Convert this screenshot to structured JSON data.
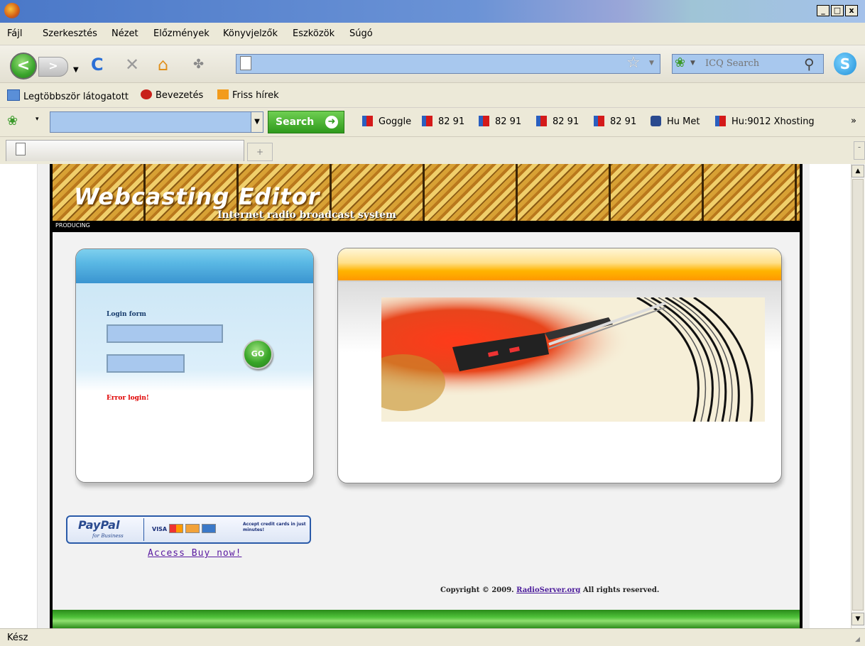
{
  "menu": [
    "Fájl",
    "Szerkesztés",
    "Nézet",
    "Előzmények",
    "Könyvjelzők",
    "Eszközök",
    "Súgó"
  ],
  "window_buttons": [
    "_",
    "□",
    "x"
  ],
  "nav": {
    "back_glyph": "<",
    "forward_glyph": ">",
    "reload_glyph": "C",
    "stop_glyph": "✕",
    "home_glyph": "⌂",
    "url_value": "",
    "bookmark_star": "☆",
    "icq_placeholder": "ICQ Search",
    "skype_glyph": "S"
  },
  "bookmarks": [
    "Legtöbbször látogatott",
    "Bevezetés",
    "Friss hírek"
  ],
  "toolbar": {
    "search_label": "Search",
    "search_value": "",
    "links": [
      "Goggle",
      "82 91",
      "82 91",
      "82 91",
      "82 91",
      "Hu Met",
      "Hu:9012 Xhosting"
    ],
    "overflow": "»"
  },
  "tabs": [
    {
      "label": ""
    }
  ],
  "newtab_glyph": "+",
  "site": {
    "banner_title": "Webcasting Editor",
    "banner_subtitle": "Internet radio broadcast system",
    "banner_tag": "PRODUCING",
    "login": {
      "label": "Login form",
      "go_label": "GO",
      "error": "Error login!"
    },
    "paypal": {
      "logo": "PayPal",
      "sub": "for Business",
      "visa": "VISA",
      "note": "Accept credit cards in just minutes!"
    },
    "access_link": "Access Buy now!",
    "copyright_pre": "Copyright © 2009.",
    "copyright_link": "RadioServer.org",
    "copyright_post": "All rights reserved."
  },
  "status": "Kész",
  "colors": {
    "accent_green": "#2f9a1c",
    "urlbar_blue": "#a8c8ee",
    "error_red": "#e00000"
  }
}
